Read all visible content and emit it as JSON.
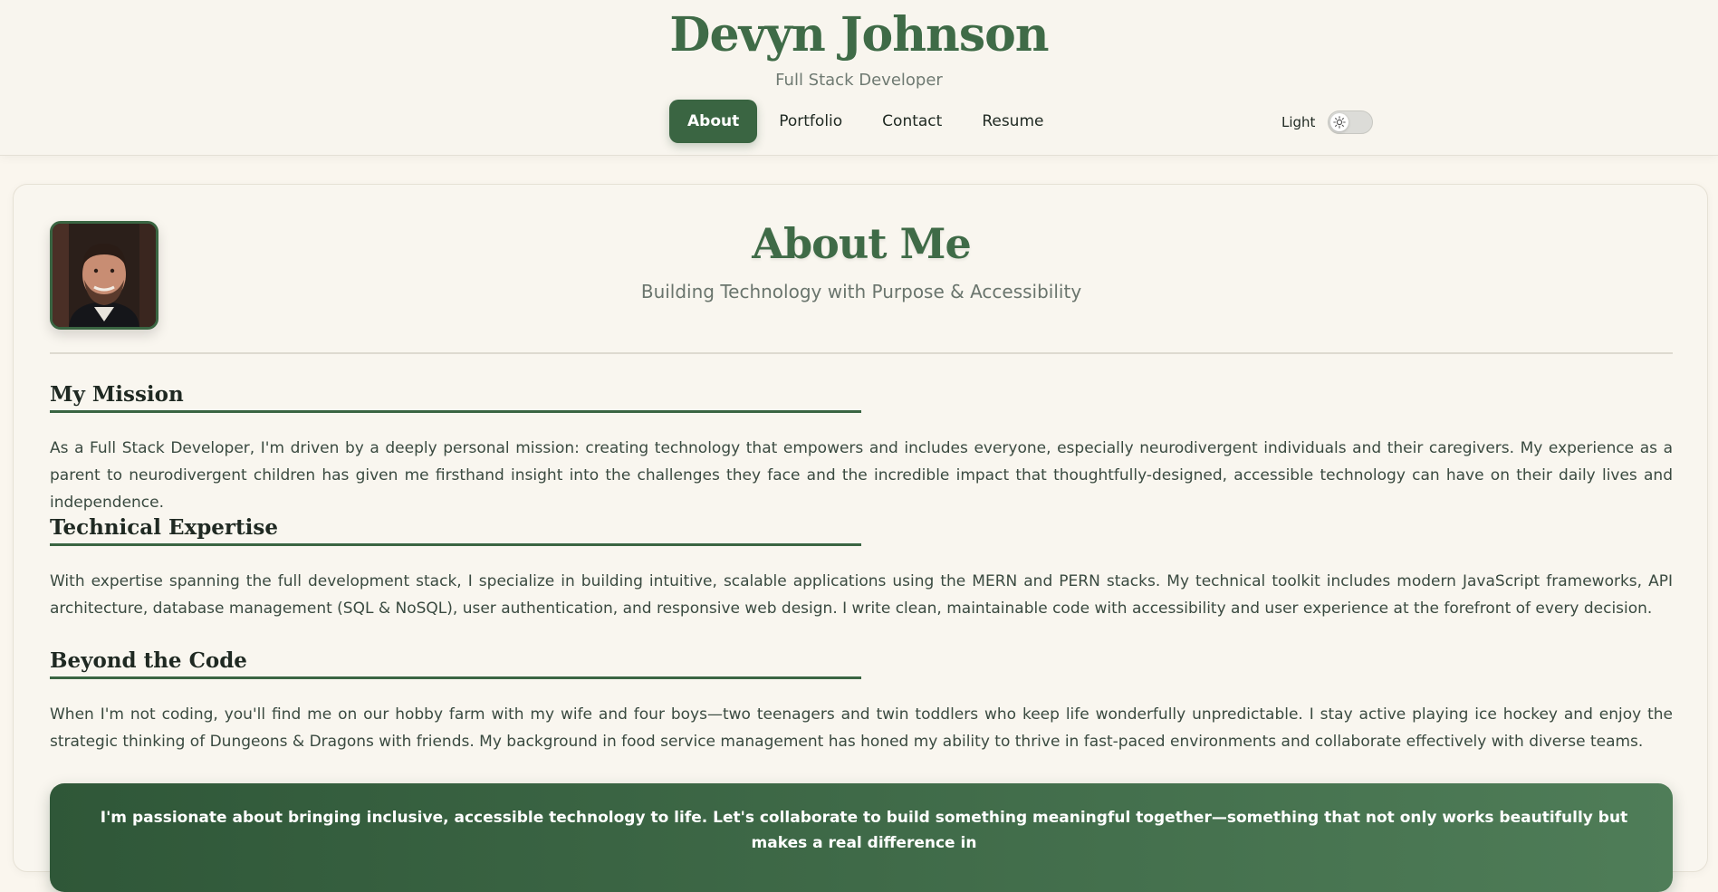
{
  "header": {
    "name": "Devyn Johnson",
    "role": "Full Stack Developer",
    "nav": [
      "About",
      "Portfolio",
      "Contact",
      "Resume"
    ],
    "active_nav": "About",
    "theme_label": "Light"
  },
  "about": {
    "title": "About Me",
    "subtitle": "Building Technology with Purpose & Accessibility",
    "sections": [
      {
        "heading": "My Mission",
        "text": "As a Full Stack Developer, I'm driven by a deeply personal mission: creating technology that empowers and includes everyone, especially neurodivergent individuals and their caregivers. My experience as a parent to neurodivergent children has given me firsthand insight into the challenges they face and the incredible impact that thoughtfully-designed, accessible technology can have on their daily lives and independence."
      },
      {
        "heading": "Technical Expertise",
        "text": "With expertise spanning the full development stack, I specialize in building intuitive, scalable applications using the MERN and PERN stacks. My technical toolkit includes modern JavaScript frameworks, API architecture, database management (SQL & NoSQL), user authentication, and responsive web design. I write clean, maintainable code with accessibility and user experience at the forefront of every decision."
      },
      {
        "heading": "Beyond the Code",
        "text": "When I'm not coding, you'll find me on our hobby farm with my wife and four boys—two teenagers and twin toddlers who keep life wonderfully unpredictable. I stay active playing ice hockey and enjoy the strategic thinking of Dungeons & Dragons with friends. My background in food service management has honed my ability to thrive in fast-paced environments and collaborate effectively with diverse teams."
      }
    ],
    "cta": "I'm passionate about bringing inclusive, accessible technology to life. Let's collaborate to build something meaningful together—something that not only works beautifully but makes a real difference in"
  },
  "colors": {
    "accent": "#3a6542",
    "title": "#3f6b47",
    "background": "#faf6ee"
  }
}
